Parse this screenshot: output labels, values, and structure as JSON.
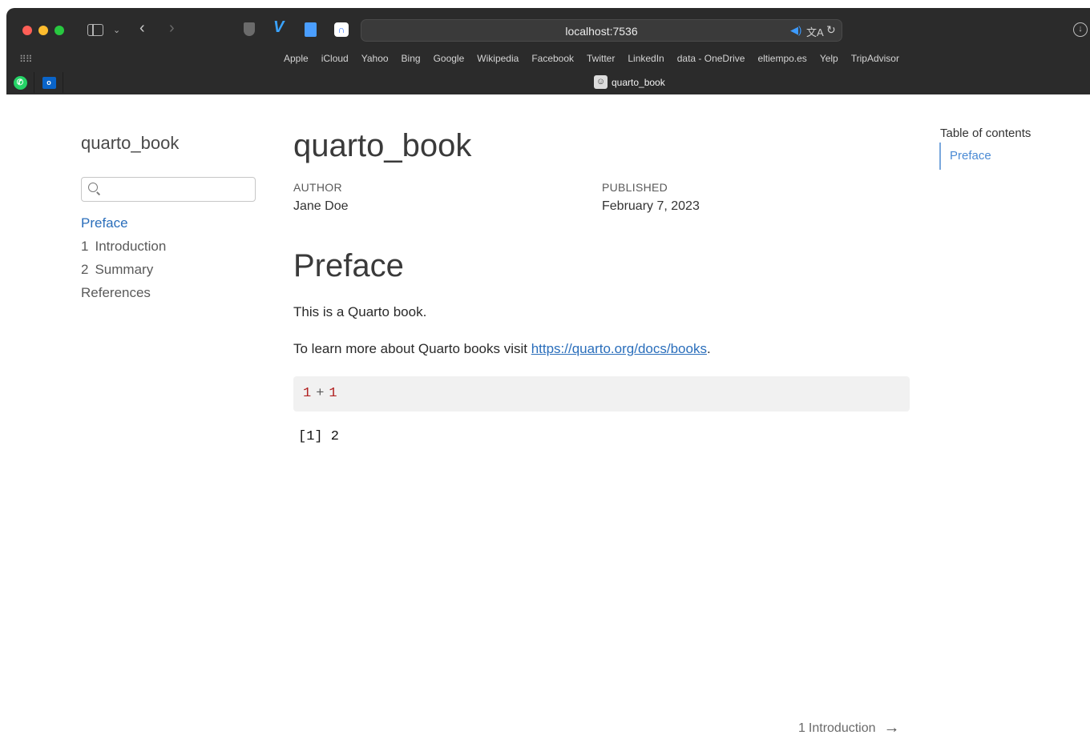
{
  "browser": {
    "url": "localhost:7536",
    "favorites": [
      "Apple",
      "iCloud",
      "Yahoo",
      "Bing",
      "Google",
      "Wikipedia",
      "Facebook",
      "Twitter",
      "LinkedIn",
      "data - OneDrive",
      "eltiempo.es",
      "Yelp",
      "TripAdvisor"
    ],
    "active_tab_title": "quarto_book"
  },
  "sidebar": {
    "title": "quarto_book",
    "search_placeholder": "",
    "items": [
      {
        "num": "",
        "label": "Preface",
        "active": true
      },
      {
        "num": "1",
        "label": "Introduction",
        "active": false
      },
      {
        "num": "2",
        "label": "Summary",
        "active": false
      },
      {
        "num": "",
        "label": "References",
        "active": false
      }
    ]
  },
  "main": {
    "title": "quarto_book",
    "author_label": "AUTHOR",
    "author": "Jane Doe",
    "published_label": "PUBLISHED",
    "published": "February 7, 2023",
    "section_title": "Preface",
    "para1": "This is a Quarto book.",
    "para2_prefix": "To learn more about Quarto books visit ",
    "para2_link": "https://quarto.org/docs/books",
    "para2_suffix": ".",
    "code": {
      "left": "1",
      "op": "+",
      "right": "1"
    },
    "output": "[1] 2"
  },
  "toc": {
    "title": "Table of contents",
    "items": [
      "Preface"
    ]
  },
  "next": {
    "num": "1",
    "label": "Introduction"
  },
  "colors": {
    "accent": "#2a6ebb",
    "chrome": "#2b2b2b",
    "code_number": "#b22222"
  }
}
